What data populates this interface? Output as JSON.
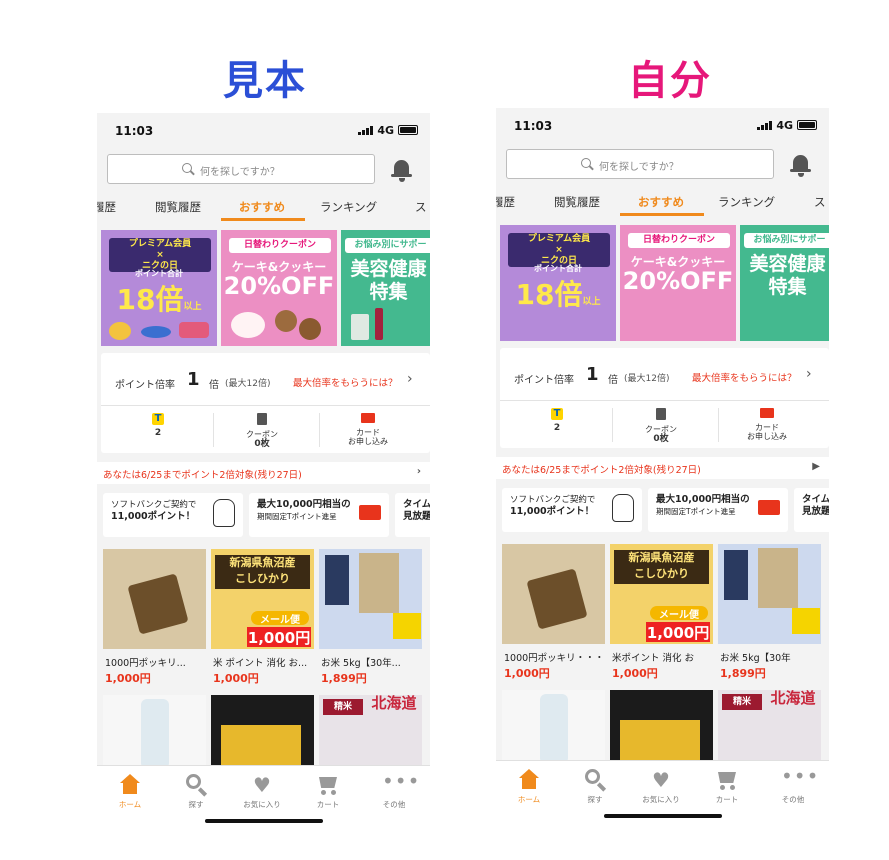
{
  "headings": {
    "left": "見本",
    "right": "自分"
  },
  "status": {
    "time": "11:03",
    "network": "4G"
  },
  "search": {
    "placeholder": "何を探しですか？"
  },
  "tabs": [
    "履歴",
    "閲覧履歴",
    "おすすめ",
    "ランキング",
    "ス"
  ],
  "banners": {
    "b1": {
      "line1": "プレミアム会員",
      "line2": "×",
      "line3": "ニクの日",
      "sub": "ポイント合計",
      "big": "18倍",
      "suffix": "以上"
    },
    "b2": {
      "tag": "日替わりクーポン",
      "line": "ケーキ&クッキー",
      "big": "20%OFF"
    },
    "b3": {
      "tag": "お悩み別にサポー",
      "big1": "美容健康",
      "big2": "特集"
    }
  },
  "points": {
    "label": "ポイント倍率",
    "value": "1",
    "unit": "倍",
    "max": "(最大12倍)",
    "link": "最大倍率をもらうには？",
    "t_count": "2",
    "coupon_label": "クーポン",
    "coupon_count": "0枚",
    "card_label": "カード",
    "card_sub": "お申し込み"
  },
  "notice": "あなたは6/25までポイント2倍対象(残り27日)",
  "promos": {
    "p1_line1": "ソフトバンクご契約で",
    "p1_line2": "11,000ポイント！",
    "p2_line1": "最大10,000円相当の",
    "p2_line2": "期間固定Tポイント進呈",
    "p3_line1": "タイム",
    "p3_line2": "見放題"
  },
  "products_left": [
    {
      "name": "1000円ポッキリ...",
      "price": "1,000円"
    },
    {
      "name": "米 ポイント 消化 お...",
      "price": "1,000円"
    },
    {
      "name": "お米 5kg【30年...",
      "price": "1,899円"
    }
  ],
  "products_right": [
    {
      "name": "1000円ポッキリ・・・",
      "price": "1,000円"
    },
    {
      "name": "米ポイント 消化 お",
      "price": "1,000円"
    },
    {
      "name": "お米 5kg【30年",
      "price": "1,899円"
    }
  ],
  "tabbar": [
    "ホーム",
    "探す",
    "お気に入り",
    "カート",
    "その他"
  ],
  "colors": {
    "accent": "#f08a1c",
    "sale": "#e8341c",
    "heading_left": "#2b4fd6",
    "heading_right": "#e6177a"
  }
}
